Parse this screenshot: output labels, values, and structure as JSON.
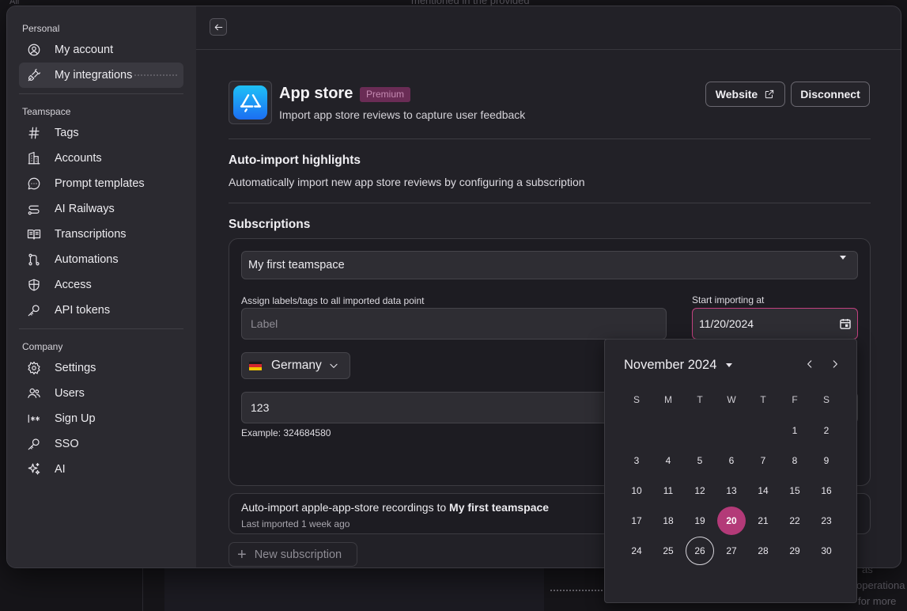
{
  "background": {
    "top_text": "mentioned in the provided",
    "left_text": "All",
    "right_text_1": "as",
    "right_text_2": "operationa",
    "right_text_3": "for more"
  },
  "sidebar": {
    "personal_title": "Personal",
    "personal_items": [
      {
        "label": "My account",
        "icon": "user-circle-icon"
      },
      {
        "label": "My integrations",
        "icon": "plug-icon",
        "active": true
      }
    ],
    "teamspace_title": "Teamspace",
    "teamspace_items": [
      {
        "label": "Tags",
        "icon": "hash-icon"
      },
      {
        "label": "Accounts",
        "icon": "building-icon"
      },
      {
        "label": "Prompt templates",
        "icon": "chat-bubble-icon"
      },
      {
        "label": "AI Railways",
        "icon": "route-icon"
      },
      {
        "label": "Transcriptions",
        "icon": "book-open-icon"
      },
      {
        "label": "Automations",
        "icon": "workflow-icon"
      },
      {
        "label": "Access",
        "icon": "shield-icon"
      },
      {
        "label": "API tokens",
        "icon": "key-icon"
      }
    ],
    "company_title": "Company",
    "company_items": [
      {
        "label": "Settings",
        "icon": "gear-icon"
      },
      {
        "label": "Users",
        "icon": "users-icon"
      },
      {
        "label": "Sign Up",
        "icon": "password-icon"
      },
      {
        "label": "SSO",
        "icon": "key-icon"
      },
      {
        "label": "AI",
        "icon": "sparkles-icon"
      }
    ]
  },
  "integration": {
    "name": "App store",
    "badge": "Premium",
    "description": "Import app store reviews to capture user feedback",
    "website_label": "Website",
    "disconnect_label": "Disconnect"
  },
  "auto_import": {
    "title": "Auto-import highlights",
    "description": "Automatically import new app store reviews by configuring a subscription"
  },
  "subscriptions": {
    "title": "Subscriptions",
    "teamspace_value": "My first teamspace",
    "labels_label": "Assign labels/tags to all imported data point",
    "labels_placeholder": "Label",
    "start_label": "Start importing at",
    "start_value": "11/20/2024",
    "country": "Germany",
    "app_id_value": "123",
    "example": "Example: 324684580",
    "recording_prefix": "Auto-import apple-app-store recordings to ",
    "recording_teamspace": "My first teamspace",
    "last_imported": "Last imported 1 week ago",
    "new_subscription_label": "New subscription"
  },
  "calendar": {
    "month_label": "November 2024",
    "weekdays": [
      "S",
      "M",
      "T",
      "W",
      "T",
      "F",
      "S"
    ],
    "first_weekday_index": 5,
    "days_in_month": 30,
    "selected_day": 20,
    "today_day": 26
  },
  "colors": {
    "accent": "#b33a78",
    "badge_bg": "#6a2c55",
    "badge_text": "#c58ab2"
  }
}
